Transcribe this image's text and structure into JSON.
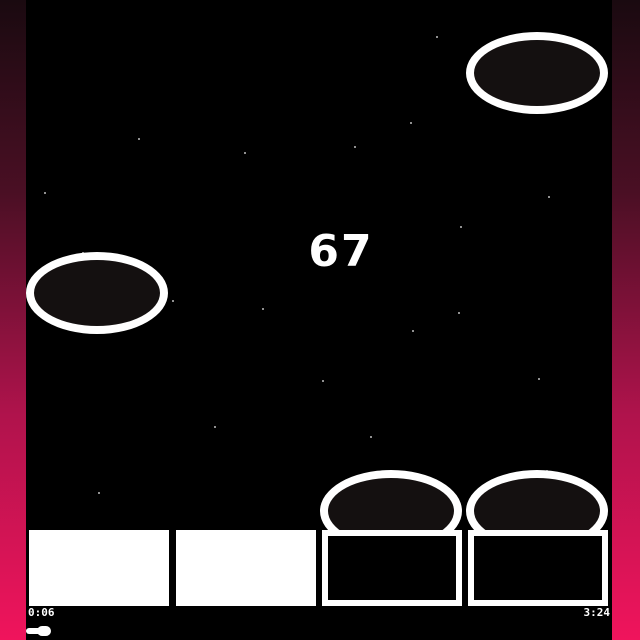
{
  "game": {
    "score": "67",
    "falling_notes": [
      {
        "id": "note-top-right"
      },
      {
        "id": "note-left"
      },
      {
        "id": "note-lane-3"
      },
      {
        "id": "note-lane-4"
      }
    ],
    "lanes": [
      {
        "id": "lane-1",
        "state": "filled"
      },
      {
        "id": "lane-2",
        "state": "filled"
      },
      {
        "id": "lane-3",
        "state": "outline"
      },
      {
        "id": "lane-4",
        "state": "outline"
      }
    ]
  },
  "player": {
    "elapsed": "0:06",
    "duration": "3:24",
    "progress_fraction": 0.03
  },
  "colors": {
    "background_gradient_top": "#1a0a10",
    "background_gradient_bottom": "#f0145c",
    "play_area": "#000000",
    "foreground": "#ffffff",
    "note_fill": "#141010"
  }
}
